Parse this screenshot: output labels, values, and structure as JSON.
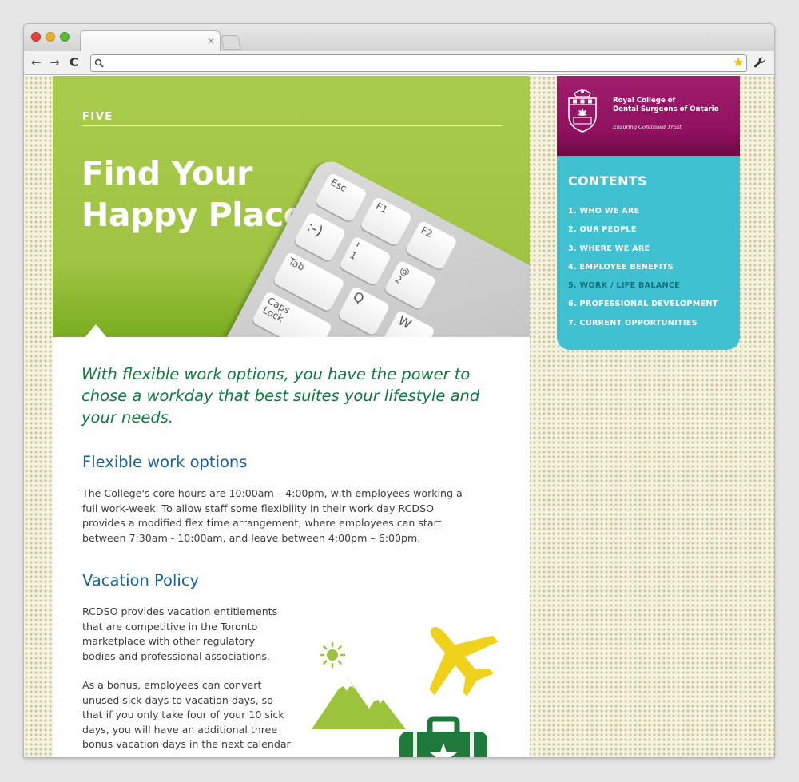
{
  "browser": {
    "tab_close": "×",
    "back": "←",
    "forward": "→",
    "reload": "C",
    "search_glyph": "⚲",
    "url": "",
    "star": "★",
    "wrench": "🔧"
  },
  "hero": {
    "eyebrow": "FIVE",
    "title_line1": "Find Your",
    "title_line2": "Happy Place",
    "keys": {
      "esc": "Esc",
      "f1": "F1",
      "f2": "F2",
      "smiley": ":-)",
      "one_top": "!",
      "one": "1",
      "two_top": "@",
      "two": "2",
      "tab": "Tab",
      "q": "Q",
      "w": "W",
      "caps_line1": "Caps",
      "caps_line2": "Lock"
    }
  },
  "article": {
    "lead": "With flexible work options, you have the power to chose a workday that best suites your lifestyle and your needs.",
    "section1_heading": "Flexible work options",
    "section1_body": "The College's core hours are 10:00am – 4:00pm, with employees working a full work-week. To allow staff some flexibility in their work day RCDSO provides a modified flex time arrangement, where employees can start between 7:30am - 10:00am, and leave between 4:00pm – 6:00pm.",
    "section2_heading": "Vacation Policy",
    "section2_body1": "RCDSO provides vacation entitlements that are competitive in the Toronto marketplace with other regulatory bodies and professional associations.",
    "section2_body2": "As a bonus, employees can convert unused sick days to vacation days, so that if you only take four of your 10 sick days, you will have an additional three bonus vacation days in the next calendar"
  },
  "sidebar": {
    "org_line1": "Royal College of",
    "org_line2": "Dental Surgeons of Ontario",
    "tagline": "Ensuring Continued Trust",
    "contents_title": "CONTENTS",
    "items": [
      {
        "label": "1. WHO WE ARE"
      },
      {
        "label": "2. OUR PEOPLE"
      },
      {
        "label": "3. WHERE WE ARE"
      },
      {
        "label": "4. EMPLOYEE BENEFITS"
      },
      {
        "label": "5. WORK / LIFE BALANCE"
      },
      {
        "label": "6. PROFESSIONAL DEVELOPMENT"
      },
      {
        "label": "7. CURRENT OPPORTUNITIES"
      }
    ],
    "active_index": 4
  },
  "colors": {
    "hero_green": "#a9cb4c",
    "lead_green": "#0f7a3e",
    "heading_blue": "#17639a",
    "logo_magenta": "#a11d6e",
    "contents_teal": "#40c1d2",
    "active_item": "#176f7d",
    "mountain_green": "#9bc33c",
    "plane_yellow": "#f0d21d",
    "suitcase_green": "#1d7a3a"
  },
  "icons": [
    "search-icon",
    "star-icon",
    "wrench-icon",
    "sun-icon",
    "mountain-icon",
    "airplane-icon",
    "suitcase-icon",
    "crest-icon"
  ]
}
